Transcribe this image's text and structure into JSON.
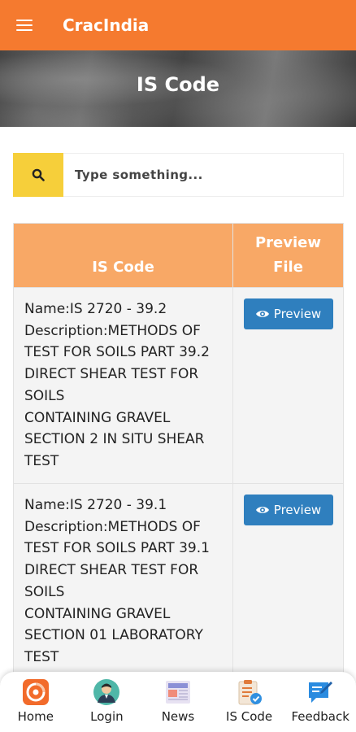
{
  "app": {
    "title": "CracIndia"
  },
  "hero": {
    "title": "IS Code"
  },
  "search": {
    "placeholder": "Type something..."
  },
  "table": {
    "headers": {
      "code": "IS Code",
      "preview": "Preview\nFile"
    },
    "rows": [
      {
        "text": "Name:IS 2720 - 39.2\nDescription:METHODS OF\nTEST FOR SOILS PART 39.2\nDIRECT SHEAR TEST FOR\nSOILS\nCONTAINING GRAVEL\nSECTION 2 IN SITU SHEAR\nTEST",
        "button": "Preview"
      },
      {
        "text": "Name:IS 2720 - 39.1\nDescription:METHODS OF\nTEST FOR SOILS PART 39.1\nDIRECT SHEAR TEST FOR\nSOILS\nCONTAINING GRAVEL\nSECTION 01 LABORATORY\nTEST",
        "button": "Preview"
      }
    ]
  },
  "nav": {
    "items": [
      {
        "label": "Home",
        "icon": "home-app-icon"
      },
      {
        "label": "Login",
        "icon": "user-avatar-icon"
      },
      {
        "label": "News",
        "icon": "newspaper-icon"
      },
      {
        "label": "IS Code",
        "icon": "clipboard-check-icon"
      },
      {
        "label": "Feedback",
        "icon": "feedback-icon"
      }
    ]
  },
  "colors": {
    "appbar": "#f57a2f",
    "table_header": "#f8a866",
    "search_button": "#f6cf3a",
    "preview_button": "#2f7fbe"
  }
}
